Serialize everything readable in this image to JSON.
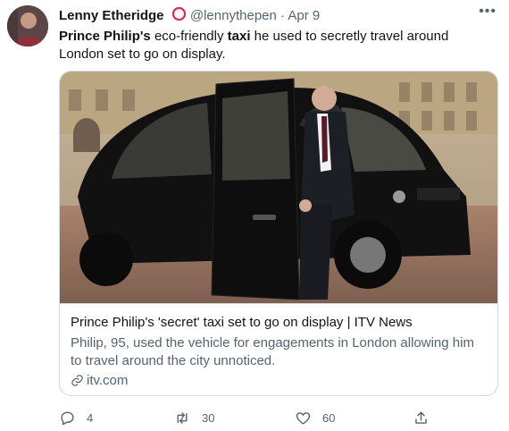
{
  "tweet": {
    "author_name": "Lenny Etheridge",
    "handle": "@lennythepen",
    "separator": "·",
    "time": "Apr 9",
    "more_label": "•••",
    "text": {
      "part1_bold": "Prince Philip's",
      "part2": " eco-friendly ",
      "part3_bold": "taxi",
      "part4": " he used to secretly travel around London set to go on display."
    }
  },
  "card": {
    "title": "Prince Philip's 'secret' taxi set to go on display | ITV News",
    "description": "Philip, 95, used the vehicle for engagements in London allowing him to travel around the city unnoticed.",
    "domain": "itv.com"
  },
  "actions": {
    "replies": "4",
    "retweets": "30",
    "likes": "60"
  },
  "colors": {
    "secondary_text": "#536471",
    "border": "#cfd9de",
    "badge": "#e0245e"
  },
  "icons": [
    "avatar",
    "circle-badge-icon",
    "more-icon",
    "link-icon",
    "reply-icon",
    "retweet-icon",
    "like-icon",
    "share-icon"
  ]
}
